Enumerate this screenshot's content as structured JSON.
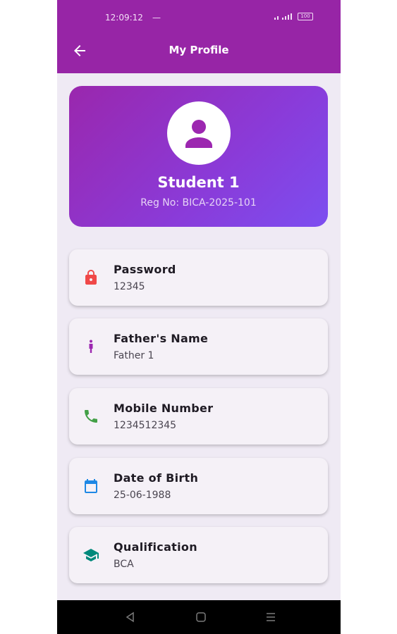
{
  "status_bar": {
    "time": "12:09:12",
    "dash": "—",
    "battery": "100"
  },
  "header": {
    "title": "My Profile"
  },
  "profile": {
    "name": "Student 1",
    "reg": "Reg No: BICA-2025-101"
  },
  "fields": [
    {
      "label": "Password",
      "value": "12345",
      "icon": "lock-icon",
      "color": "#f04848"
    },
    {
      "label": "Father's Name",
      "value": "Father 1",
      "icon": "person-icon",
      "color": "#9c27b0"
    },
    {
      "label": "Mobile Number",
      "value": "1234512345",
      "icon": "phone-icon",
      "color": "#43a047"
    },
    {
      "label": "Date of Birth",
      "value": "25-06-1988",
      "icon": "calendar-icon",
      "color": "#1e88e5"
    },
    {
      "label": "Qualification",
      "value": "BCA",
      "icon": "graduation-cap-icon",
      "color": "#00897b"
    }
  ],
  "colors": {
    "app_bar": "#9725a6",
    "background": "#efeaf4",
    "gradient_end": "#7c4ef0"
  }
}
